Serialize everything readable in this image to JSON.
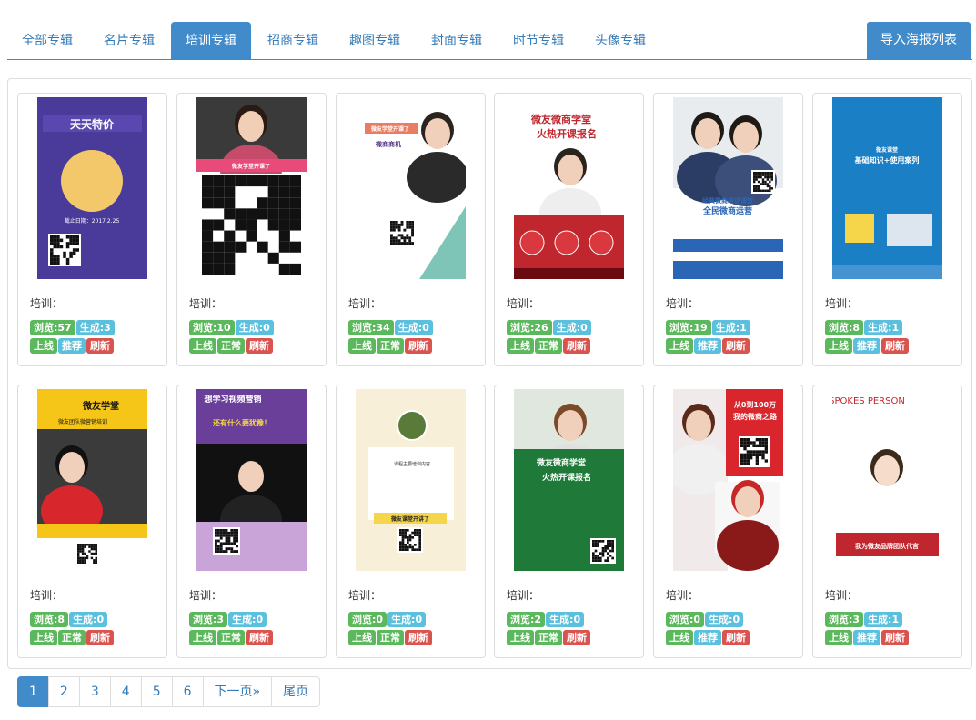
{
  "tabs": [
    {
      "label": "全部专辑",
      "active": false
    },
    {
      "label": "名片专辑",
      "active": false
    },
    {
      "label": "培训专辑",
      "active": true
    },
    {
      "label": "招商专辑",
      "active": false
    },
    {
      "label": "趣图专辑",
      "active": false
    },
    {
      "label": "封面专辑",
      "active": false
    },
    {
      "label": "时节专辑",
      "active": false
    },
    {
      "label": "头像专辑",
      "active": false
    }
  ],
  "import_button": "导入海报列表",
  "cards": [
    {
      "title": "培训：",
      "views": "浏览:57",
      "generated": "生成:3",
      "online": "上线",
      "status": "推荐",
      "refresh": "刷新",
      "poster": {
        "heading": "天天特价",
        "sub": "截止日期：2017.2.25",
        "bg": "#4a3a9a"
      }
    },
    {
      "title": "培训：",
      "views": "浏览:10",
      "generated": "生成:0",
      "online": "上线",
      "status": "正常",
      "refresh": "刷新",
      "poster": {
        "heading": "微友学堂开课了",
        "sub": "",
        "bg": "#ffffff"
      }
    },
    {
      "title": "培训：",
      "views": "浏览:34",
      "generated": "生成:0",
      "online": "上线",
      "status": "正常",
      "refresh": "刷新",
      "poster": {
        "heading": "微友学堂开课了",
        "sub": "微商商机",
        "bg": "#ffffff"
      }
    },
    {
      "title": "培训：",
      "views": "浏览:26",
      "generated": "生成:0",
      "online": "上线",
      "status": "正常",
      "refresh": "刷新",
      "poster": {
        "heading": "微友微商学堂",
        "sub": "火热开课报名",
        "bg": "#ffffff"
      }
    },
    {
      "title": "培训：",
      "views": "浏览:19",
      "generated": "生成:1",
      "online": "上线",
      "status": "推荐",
      "refresh": "刷新",
      "poster": {
        "heading": "经典微商培训课堂",
        "sub": "全民微商运营",
        "bg": "#ffffff"
      }
    },
    {
      "title": "培训：",
      "views": "浏览:8",
      "generated": "生成:1",
      "online": "上线",
      "status": "推荐",
      "refresh": "刷新",
      "poster": {
        "heading": "基础知识+使用案列",
        "sub": "微友课堂",
        "bg": "#1a7fc4"
      }
    },
    {
      "title": "培训：",
      "views": "浏览:8",
      "generated": "生成:0",
      "online": "上线",
      "status": "正常",
      "refresh": "刷新",
      "poster": {
        "heading": "微友学堂",
        "sub": "微友团队微营销培训",
        "bg": "#f5c518"
      }
    },
    {
      "title": "培训：",
      "views": "浏览:3",
      "generated": "生成:0",
      "online": "上线",
      "status": "正常",
      "refresh": "刷新",
      "poster": {
        "heading": "想学习视频营销",
        "sub": "还有什么要犹豫！",
        "bg": "#6a3f9a"
      }
    },
    {
      "title": "培训：",
      "views": "浏览:0",
      "generated": "生成:0",
      "online": "上线",
      "status": "正常",
      "refresh": "刷新",
      "poster": {
        "heading": "微友课堂开讲了",
        "sub": "课程主要培训内容",
        "bg": "#f8efd8"
      }
    },
    {
      "title": "培训：",
      "views": "浏览:2",
      "generated": "生成:0",
      "online": "上线",
      "status": "正常",
      "refresh": "刷新",
      "poster": {
        "heading": "微友微商学堂",
        "sub": "火热开课报名",
        "bg": "#1f7a3a"
      }
    },
    {
      "title": "培训：",
      "views": "浏览:0",
      "generated": "生成:0",
      "online": "上线",
      "status": "推荐",
      "refresh": "刷新",
      "poster": {
        "heading": "从0到100万",
        "sub": "我的微商之路",
        "bg": "#ffffff"
      }
    },
    {
      "title": "培训：",
      "views": "浏览:3",
      "generated": "生成:1",
      "online": "上线",
      "status": "推荐",
      "refresh": "刷新",
      "poster": {
        "heading": "SPOKES PERSON",
        "sub": "我为微友品牌团队代言",
        "bg": "#ffffff"
      }
    }
  ],
  "pagination": [
    "1",
    "2",
    "3",
    "4",
    "5",
    "6",
    "下一页»",
    "尾页"
  ],
  "colors": {
    "primary": "#428bca",
    "green": "#5cb85c",
    "info": "#5bc0de",
    "danger": "#d9534f"
  }
}
